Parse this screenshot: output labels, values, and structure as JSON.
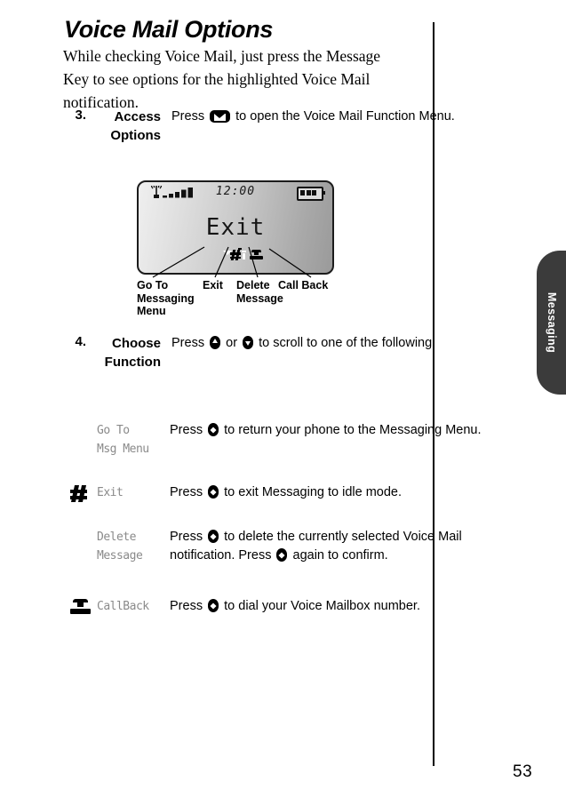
{
  "document": {
    "section_title": "Voice Mail Options",
    "intro": "While checking Voice Mail, just press the Message Key to see options for the highlighted Voice Mail notification.",
    "page_number": "53",
    "thumb_tab": "Messaging"
  },
  "steps": [
    {
      "number": "3.",
      "title_line1": "Access",
      "title_line2": "Options",
      "body_pre": "Press",
      "body_post": "to open the Voice Mail Function Menu.",
      "key_icon": "message-key-icon"
    },
    {
      "number": "4.",
      "title_line1": "Choose",
      "title_line2": "Function",
      "body_pre": "Press",
      "body_mid": "or",
      "body_post": "to scroll to one of the following:",
      "key_icon_up": "scroll-up-key-icon",
      "key_icon_down": "scroll-down-key-icon"
    }
  ],
  "phone_display": {
    "status": {
      "signal_icon": "signal-strength-icon",
      "signal_bars": 5,
      "clock": "12:00",
      "battery_icon": "battery-icon",
      "battery_bars": 3
    },
    "screen_text": "Exit",
    "soft_icons": [
      {
        "name": "go-to-messaging-icon",
        "selected": false
      },
      {
        "name": "exit-icon",
        "selected": false
      },
      {
        "name": "delete-message-icon",
        "selected": true
      },
      {
        "name": "call-back-icon",
        "selected": false
      }
    ]
  },
  "callouts": [
    {
      "label": "Go To Messaging Menu"
    },
    {
      "label": "Exit"
    },
    {
      "label": "Delete Message"
    },
    {
      "label": "Call Back"
    }
  ],
  "functions": [
    {
      "icon": "go-to-msg-menu-icon",
      "lcd_label_line1": "Go To",
      "lcd_label_line2": "Msg Menu",
      "desc_pre": "Press",
      "desc_post": "to return your phone to the Messaging Menu."
    },
    {
      "icon": "exit-icon",
      "lcd_label_line1": "Exit",
      "lcd_label_line2": "",
      "desc_pre": "Press",
      "desc_post": "to exit Messaging to idle mode."
    },
    {
      "icon": "delete-message-icon",
      "lcd_label_line1": "Delete",
      "lcd_label_line2": "Message",
      "desc_pre": "Press",
      "desc_mid": "to delete the currently selected Voice Mail notification. Press",
      "desc_post": "again to confirm."
    },
    {
      "icon": "call-back-icon",
      "lcd_label_line1": "CallBack",
      "lcd_label_line2": "",
      "desc_pre": "Press",
      "desc_post": "to dial your Voice Mailbox number."
    }
  ],
  "colors": {
    "ink": "#000000",
    "lcd_label_grey": "#8a8a8a",
    "tab_dark": "#3b3b3b"
  }
}
